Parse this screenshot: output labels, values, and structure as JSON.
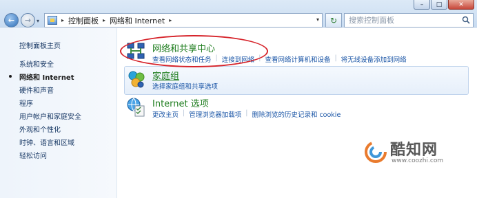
{
  "window": {
    "minimize_label": "–",
    "maximize_label": "□",
    "close_label": "✕"
  },
  "address_bar": {
    "crumbs": [
      "控制面板",
      "网络和 Internet"
    ],
    "separator": "▸",
    "dropdown": "▾"
  },
  "search": {
    "placeholder": "搜索控制面板"
  },
  "nav": {
    "back_symbol": "←",
    "forward_symbol": "→",
    "history_dropdown": "▾",
    "refresh_symbol": "↻"
  },
  "left_pane": {
    "items": [
      {
        "label": "控制面板主页"
      },
      {
        "label": "系统和安全"
      },
      {
        "label": "网络和 Internet",
        "current": true
      },
      {
        "label": "硬件和声音"
      },
      {
        "label": "程序"
      },
      {
        "label": "用户帐户和家庭安全"
      },
      {
        "label": "外观和个性化"
      },
      {
        "label": "时钟、语言和区域"
      },
      {
        "label": "轻松访问"
      }
    ]
  },
  "categories": [
    {
      "title": "网络和共享中心",
      "icon": "network-center-icon",
      "links": [
        "查看网络状态和任务",
        "连接到网络",
        "查看网络计算机和设备",
        "将无线设备添加到网络"
      ]
    },
    {
      "title": "家庭组",
      "icon": "homegroup-icon",
      "links": [
        "选择家庭组和共享选项"
      ]
    },
    {
      "title": "Internet 选项",
      "icon": "internet-options-icon",
      "links": [
        "更改主页",
        "管理浏览器加载项",
        "删除浏览的历史记录和 cookie"
      ]
    }
  ],
  "annotation": {
    "color": "#d6232a"
  },
  "watermark": {
    "name": "酷知网",
    "url": "www.coozhi.com"
  },
  "colors": {
    "category_title": "#1e7d1e",
    "link": "#1a55a6",
    "nav_text": "#1a3a66"
  }
}
